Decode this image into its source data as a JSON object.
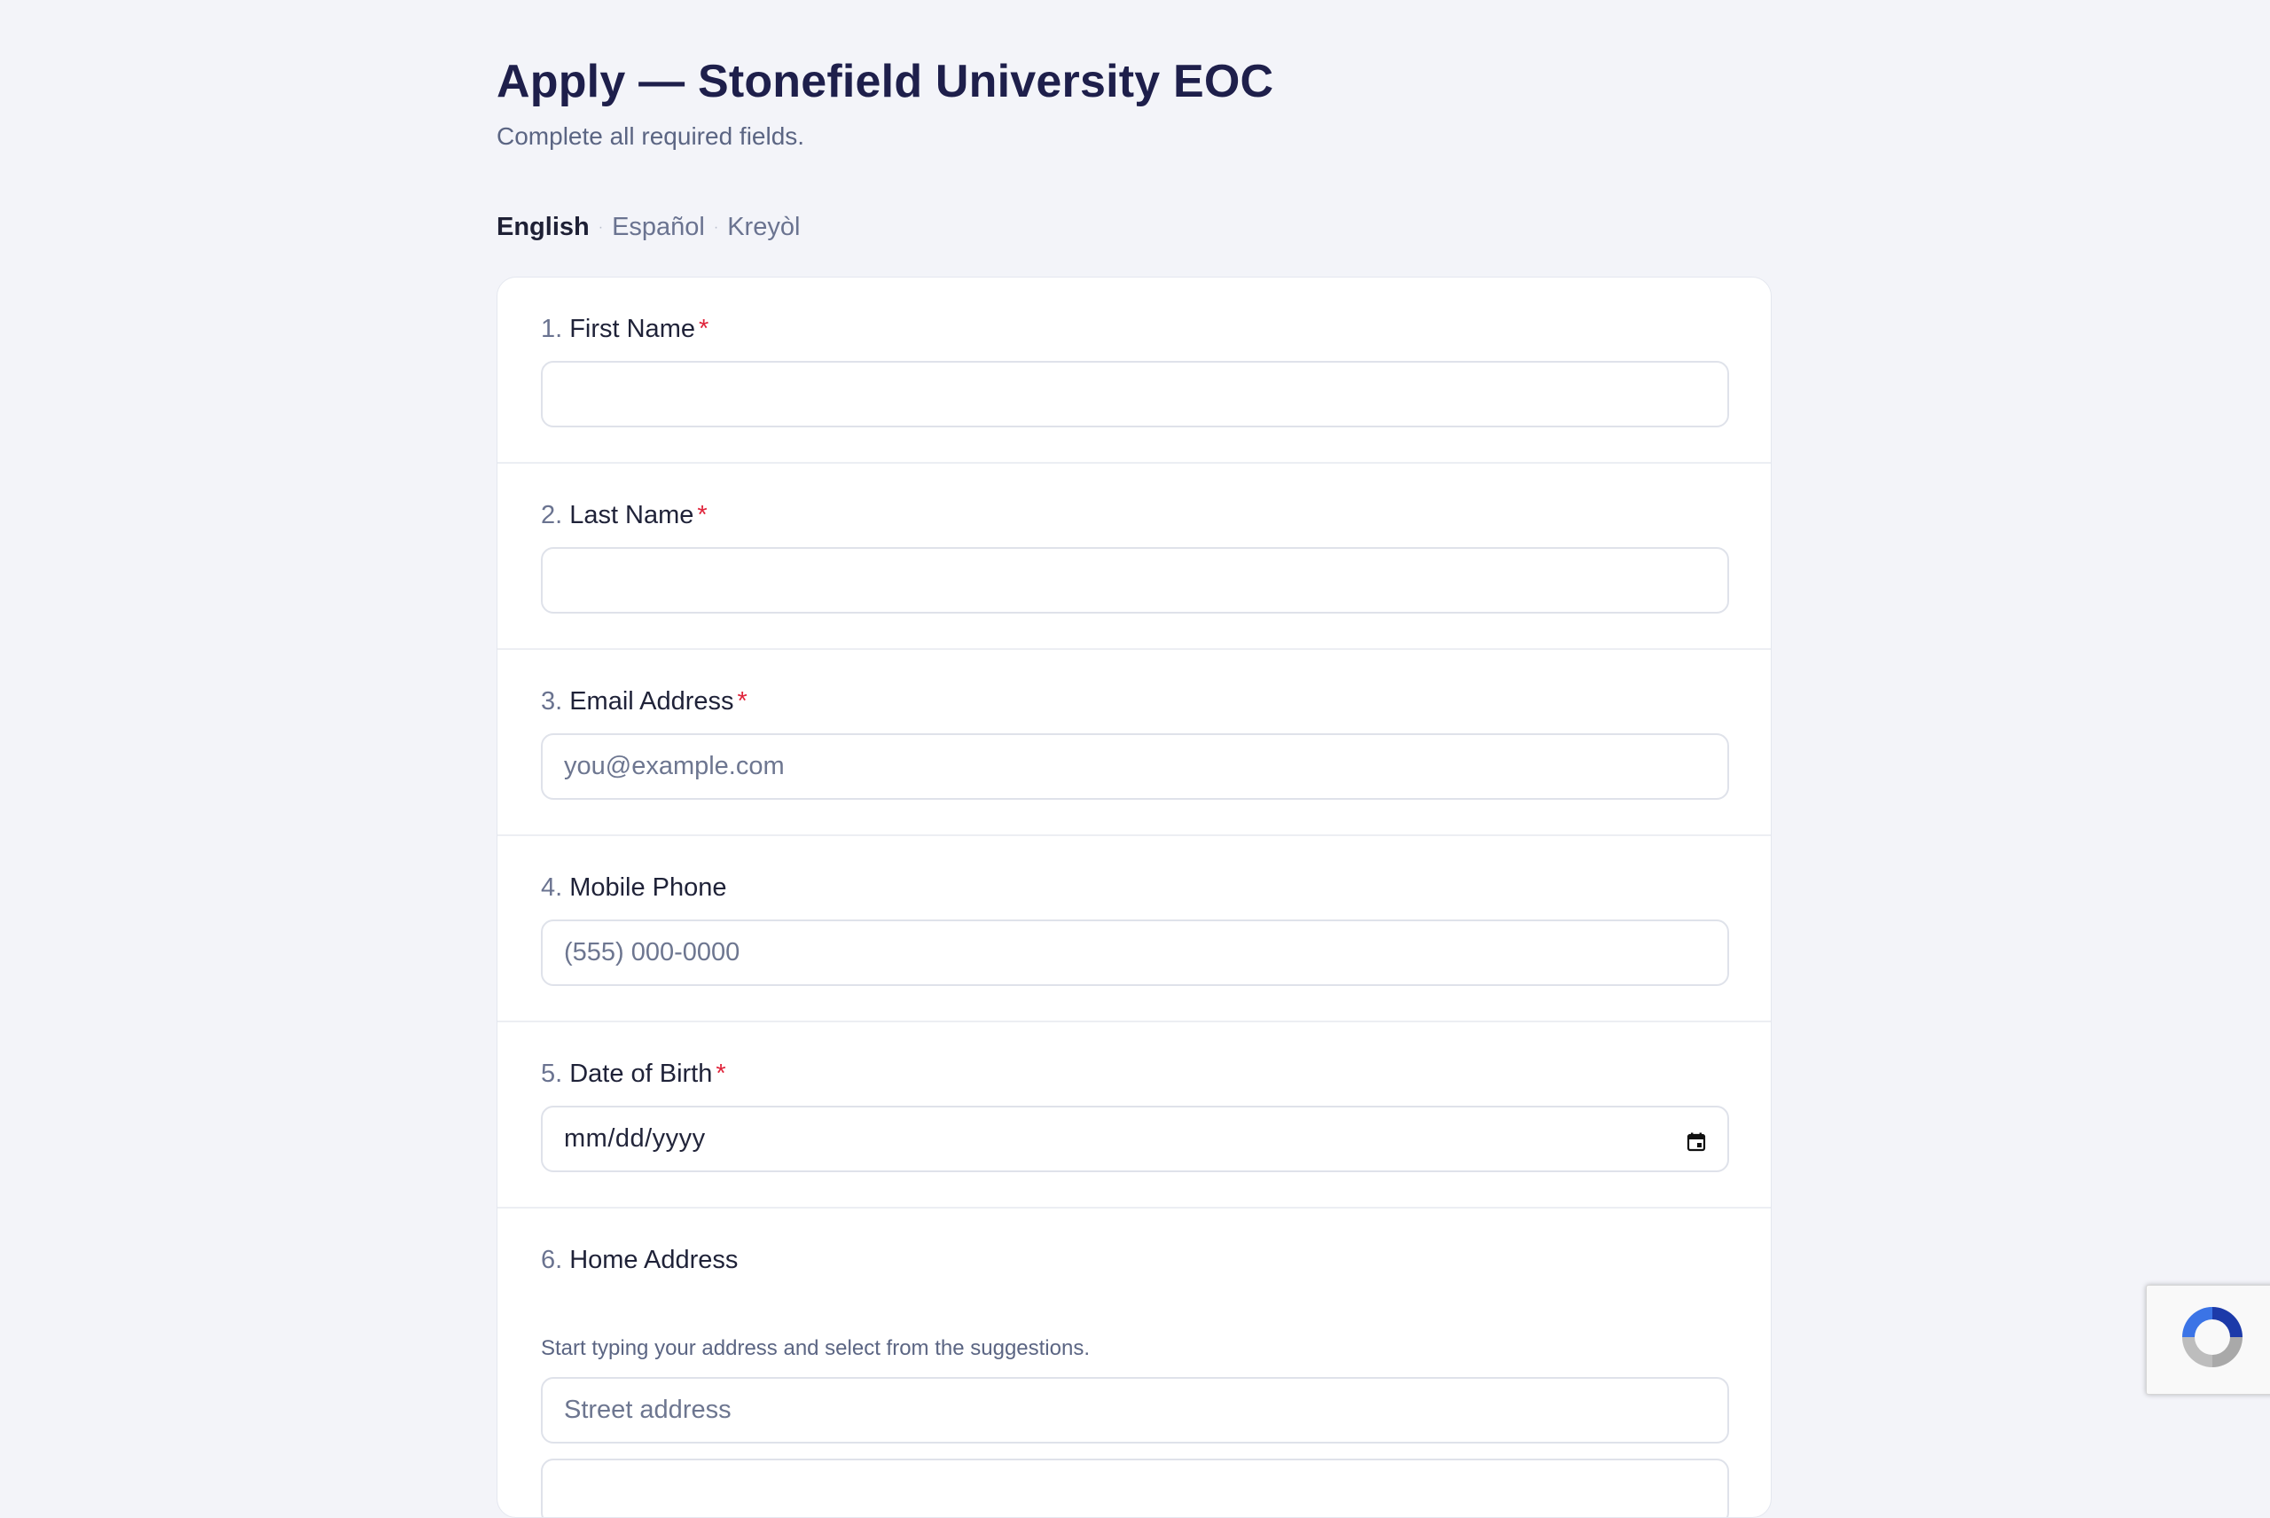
{
  "header": {
    "title": "Apply — Stonefield University EOC",
    "subtitle": "Complete all required fields."
  },
  "languages": {
    "items": [
      "English",
      "Español",
      "Kreyòl"
    ],
    "selected": "English",
    "separator": "·"
  },
  "form": {
    "required_marker": "*",
    "questions": [
      {
        "number": "1.",
        "label": "First Name",
        "required": true,
        "value": "",
        "placeholder": ""
      },
      {
        "number": "2.",
        "label": "Last Name",
        "required": true,
        "value": "",
        "placeholder": ""
      },
      {
        "number": "3.",
        "label": "Email Address",
        "required": true,
        "value": "",
        "placeholder": "you@example.com"
      },
      {
        "number": "4.",
        "label": "Mobile Phone",
        "required": false,
        "value": "",
        "placeholder": "(555) 000-0000"
      },
      {
        "number": "5.",
        "label": "Date of Birth",
        "required": true,
        "value": "",
        "placeholder": "mm/dd/yyyy"
      },
      {
        "number": "6.",
        "label": "Home Address",
        "required": false,
        "help": "Start typing your address and select from the suggestions.",
        "value": "",
        "placeholder": "Street address"
      }
    ]
  },
  "icons": {
    "date_picker": "calendar-icon",
    "recaptcha": "recaptcha-logo-icon"
  },
  "colors": {
    "background": "#f3f4f9",
    "title": "#1e1f4b",
    "required": "#e0243b",
    "muted": "#5b6583",
    "recaptcha_blue": "#3b74e6",
    "recaptcha_gray": "#a9a9a9"
  }
}
